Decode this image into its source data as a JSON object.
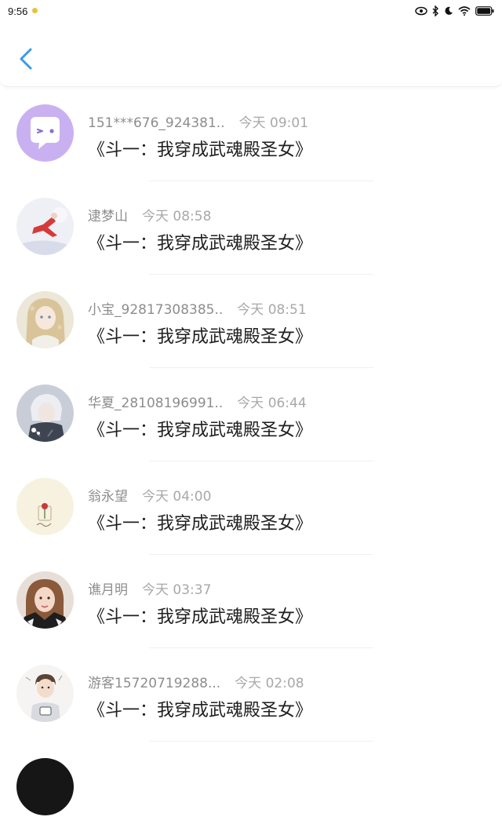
{
  "status_bar": {
    "time": "9:56"
  },
  "messages": [
    {
      "name": "151***676_924381..",
      "time": "今天 09:01",
      "title": "《斗一：我穿成武魂殿圣女》",
      "avatar": "chat-bubble"
    },
    {
      "name": "逮梦山",
      "time": "今天 08:58",
      "title": "《斗一：我穿成武魂殿圣女》",
      "avatar": "red-figure"
    },
    {
      "name": "小宝_92817308385..",
      "time": "今天 08:51",
      "title": "《斗一：我穿成武魂殿圣女》",
      "avatar": "anime-girl"
    },
    {
      "name": "华夏_28108196991..",
      "time": "今天 06:44",
      "title": "《斗一：我穿成武魂殿圣女》",
      "avatar": "anime-boy"
    },
    {
      "name": "翁永望",
      "time": "今天 04:00",
      "title": "《斗一：我穿成武魂殿圣女》",
      "avatar": "rose"
    },
    {
      "name": "谯月明",
      "time": "今天 03:37",
      "title": "《斗一：我穿成武魂殿圣女》",
      "avatar": "photo-woman"
    },
    {
      "name": "游客15720719288...",
      "time": "今天 02:08",
      "title": "《斗一：我穿成武魂殿圣女》",
      "avatar": "cartoon-boy"
    },
    {
      "name": "",
      "time": "",
      "title": "",
      "avatar": "dark-partial"
    }
  ],
  "colors": {
    "accent": "#3b9be6",
    "name_gray": "#8d8d8d",
    "time_gray": "#a8a8a8"
  }
}
